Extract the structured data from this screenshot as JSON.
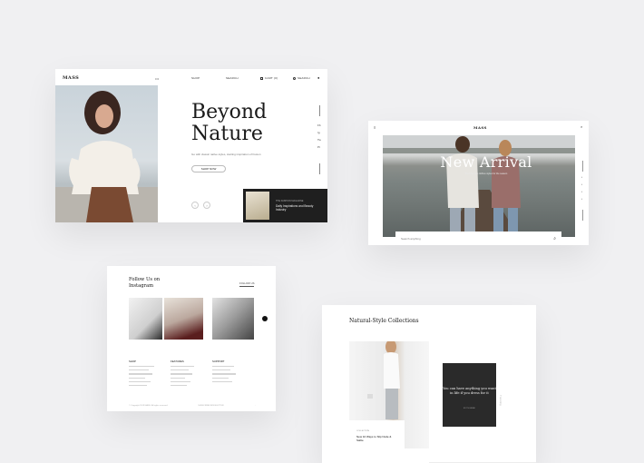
{
  "card1": {
    "logo": "MASS",
    "nav_dot": "•••",
    "nav": [
      "SHOP",
      "SEARCH",
      "CART (0)",
      "SEARCH"
    ],
    "headline_line1": "Beyond",
    "headline_line2": "Nature",
    "subtext": "Go with classic native styles, starting inspiration of Fusion",
    "shop_button": "SHOP NOW",
    "arrow_prev": "‹",
    "arrow_next": "›",
    "social": [
      "Fb",
      "Ig",
      "Tw",
      "Pt"
    ],
    "promo_label": "THE FASHION MAGAZINE",
    "promo_title": "Daily Inspirations and Beauty Industry"
  },
  "card2": {
    "logo": "MASS",
    "menu_icon": "≡",
    "close_icon": "×",
    "title": "New Arrival",
    "title_sub": "Find the new clothes styles for the season",
    "search_placeholder": "Search anything",
    "search_icon": "⌕",
    "rail_dots": [
      "•",
      "•",
      "•",
      "•"
    ]
  },
  "card3": {
    "title_line1": "Follow Us on",
    "title_line2": "Instagram",
    "follow_link": "FOLLOW US",
    "columns": [
      "SHOP",
      "FEATURES",
      "SUPPORT"
    ],
    "footer_left": "© Copyright 2019 MASS. All rights reserved.",
    "footer_mid": "SUBSCRIBE NEWSLETTER",
    "footer_right": "→"
  },
  "card4": {
    "title": "Natural-Style Collections",
    "caption_label": "COLLECTION",
    "caption_title": "New 10 Ways to Slip Nude & Sable",
    "quote": "You can have anything you want in life if you dress for it",
    "quote_author": "EDITH HEAD",
    "vertical_label": "Trending"
  }
}
